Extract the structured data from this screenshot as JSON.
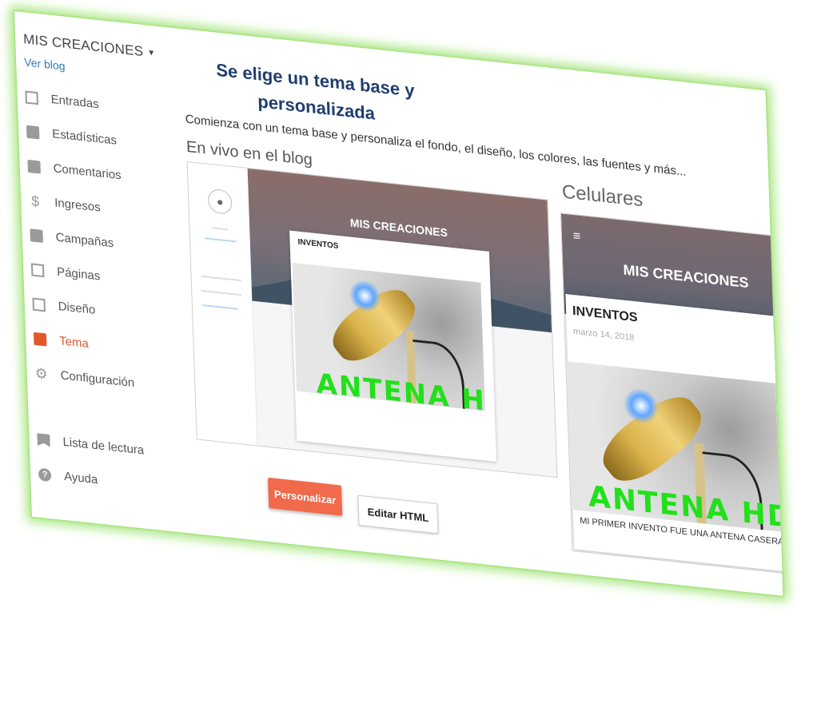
{
  "sidebar": {
    "blog_title": "MIS CREACIONES",
    "view_blog": "Ver blog",
    "items": [
      {
        "label": "Entradas",
        "icon": "posts-icon"
      },
      {
        "label": "Estadísticas",
        "icon": "stats-icon"
      },
      {
        "label": "Comentarios",
        "icon": "comments-icon"
      },
      {
        "label": "Ingresos",
        "icon": "dollar-icon"
      },
      {
        "label": "Campañas",
        "icon": "campaigns-icon"
      },
      {
        "label": "Páginas",
        "icon": "pages-icon"
      },
      {
        "label": "Diseño",
        "icon": "layout-icon"
      },
      {
        "label": "Tema",
        "icon": "paint-roller-icon",
        "active": true
      },
      {
        "label": "Configuración",
        "icon": "gear-icon"
      },
      {
        "label": "Lista de lectura",
        "icon": "bookmark-icon"
      },
      {
        "label": "Ayuda",
        "icon": "help-icon"
      }
    ]
  },
  "main": {
    "heading_line1": "Se elige un tema base y",
    "heading_line2": "personalizada",
    "subtitle": "Comienza con un tema base y personaliza el fondo, el diseño, los colores, las fuentes y más...",
    "live_label": "En vivo en el blog",
    "mobile_label": "Celulares"
  },
  "desktop_preview": {
    "blog_title": "MIS CREACIONES",
    "post_title": "INVENTOS",
    "image_text": "ANTENA HDTV"
  },
  "mobile_preview": {
    "blog_title": "MIS CREACIONES",
    "post_title": "INVENTOS",
    "post_date": "marzo 14, 2018",
    "image_text": "ANTENA HDTV",
    "caption": "MI PRIMER INVENTO FUE UNA ANTENA CASERA"
  },
  "buttons": {
    "customize": "Personalizar",
    "edit_html": "Editar HTML"
  },
  "colors": {
    "accent": "#e3572b",
    "button": "#f06a4b",
    "heading": "#1f3e6e",
    "glow": "#a6e57e"
  }
}
